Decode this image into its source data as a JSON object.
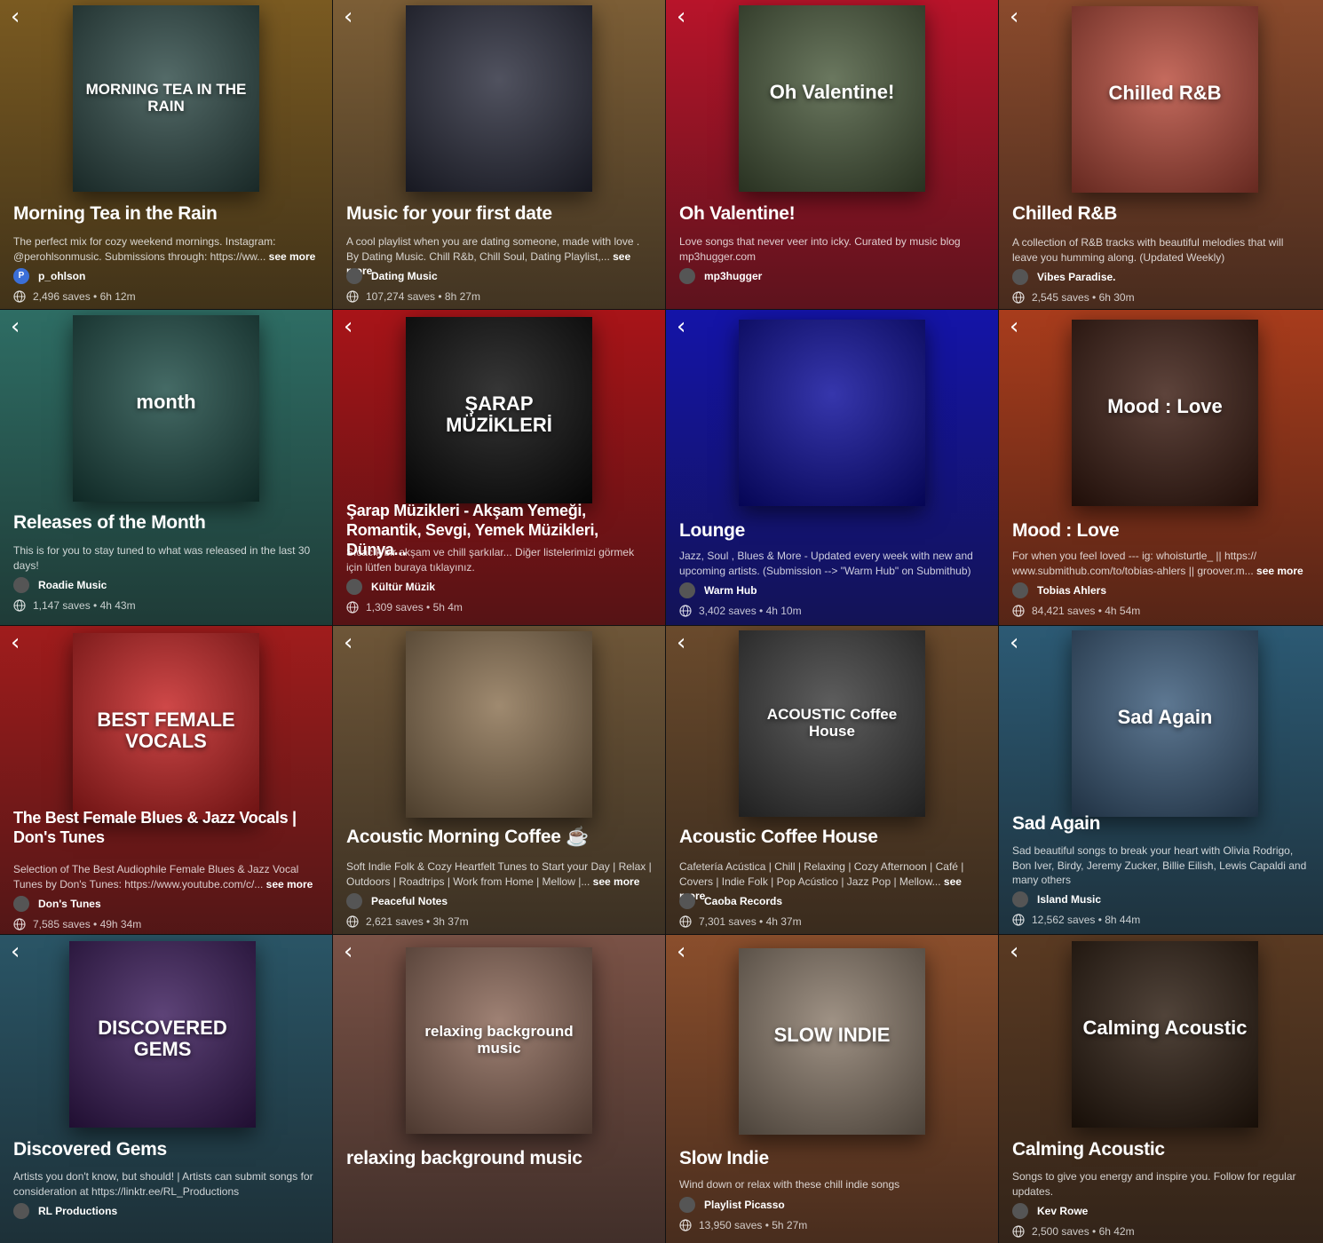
{
  "ui": {
    "back_glyph": "‹",
    "see_more": "see more"
  },
  "playlists": [
    {
      "title": "Morning Tea in the Rain",
      "cover_text": "MORNING TEA IN THE RAIN",
      "description": "The perfect mix for cozy weekend mornings. Instagram: @perohlsonmusic. Submissions through: https://ww...",
      "owner": "p_ohlson",
      "avatar_letter": "P",
      "saves": "2,496 saves",
      "duration": "6h 12m",
      "colors": {
        "bg": "#7a5a21",
        "art": "#2e4a47"
      }
    },
    {
      "title": "Music for your first date",
      "cover_text": "",
      "description": "A cool playlist when you are dating someone, made with love . By Dating Music. Chill R&b, Chill Soul, Dating Playlist,...",
      "owner": "Dating Music",
      "avatar_letter": "",
      "saves": "107,274 saves",
      "duration": "8h 27m",
      "colors": {
        "bg": "#7c5e36",
        "art": "#2a2c3c"
      }
    },
    {
      "title": "Oh Valentine!",
      "cover_text": "Oh Valentine!",
      "description": "Love songs that never veer into icky. Curated by music blog mp3hugger.com",
      "owner": "mp3hugger",
      "avatar_letter": "",
      "saves": "",
      "duration": "",
      "colors": {
        "bg": "#b8142a",
        "art": "#4a5a3c"
      }
    },
    {
      "title": "Chilled R&B",
      "cover_text": "Chilled R&B",
      "description": "A collection of R&B tracks with beautiful melodies that will leave you humming along. (Updated Weekly)",
      "owner": "Vibes Paradise.",
      "avatar_letter": "",
      "saves": "2,545 saves",
      "duration": "6h 30m",
      "colors": {
        "bg": "#8a4a2c",
        "art": "#b84a3a"
      }
    },
    {
      "title": "Releases of the Month",
      "cover_text": "month",
      "description": "This is for you to stay tuned to what was released in the last 30 days!",
      "owner": "Roadie Music",
      "avatar_letter": "",
      "saves": "1,147 saves",
      "duration": "4h 43m",
      "colors": {
        "bg": "#2e6d64",
        "art": "#1c4a44"
      }
    },
    {
      "title": "Şarap Müzikleri - Akşam Yemeği, Romantik, Sevgi, Yemek Müzikleri, Dünya...",
      "cover_text": "ŞARAP MÜZİKLERİ",
      "description": "Sıcacık bir akşam ve chill şarkılar... Diğer listelerimizi görmek için lütfen buraya tıklayınız.",
      "owner": "Kültür Müzik",
      "avatar_letter": "",
      "saves": "1,309 saves",
      "duration": "5h 4m",
      "colors": {
        "bg": "#a81418",
        "art": "#0a0a0a"
      }
    },
    {
      "title": "Lounge",
      "cover_text": "",
      "description": "Jazz, Soul , Blues & More - Updated every week with new and upcoming artists. (Submission --> \"Warm Hub\" on Submithub)",
      "owner": "Warm Hub",
      "avatar_letter": "",
      "saves": "3,402 saves",
      "duration": "4h 10m",
      "colors": {
        "bg": "#1414a8",
        "art": "#0a0a9a"
      }
    },
    {
      "title": "Mood : Love",
      "cover_text": "Mood : Love",
      "description": "For when you feel loved --- ig: whoisturtle_ || https:// www.submithub.com/to/tobias-ahlers || groover.m...",
      "owner": "Tobias Ahlers",
      "avatar_letter": "",
      "saves": "84,421 saves",
      "duration": "4h 54m",
      "colors": {
        "bg": "#a83c1c",
        "art": "#3a1a10"
      }
    },
    {
      "title": "The Best Female Blues & Jazz Vocals | Don's Tunes",
      "cover_text": "BEST FEMALE VOCALS",
      "description": "Selection of The Best Audiophile Female Blues & Jazz Vocal Tunes by Don's Tunes: https://www.youtube.com/c/...",
      "owner": "Don's Tunes",
      "avatar_letter": "",
      "saves": "7,585 saves",
      "duration": "49h 34m",
      "colors": {
        "bg": "#a01c1c",
        "art": "#c42020"
      }
    },
    {
      "title": "Acoustic Morning Coffee ☕",
      "cover_text": "",
      "description": "Soft Indie Folk & Cozy Heartfelt Tunes to Start your Day | Relax | Outdoors | Roadtrips | Work from Home | Mellow |...",
      "owner": "Peaceful Notes",
      "avatar_letter": "",
      "saves": "2,621 saves",
      "duration": "3h 37m",
      "colors": {
        "bg": "#6e5638",
        "art": "#8a7050"
      }
    },
    {
      "title": "Acoustic Coffee House",
      "cover_text": "ACOUSTIC Coffee House",
      "description": "Cafetería Acústica | Chill | Relaxing | Cozy Afternoon | Café | Covers | Indie Folk | Pop Acústico | Jazz Pop | Mellow...",
      "owner": "Caoba Records",
      "avatar_letter": "",
      "saves": "7,301 saves",
      "duration": "4h 37m",
      "colors": {
        "bg": "#6a4a2c",
        "art": "#3a3a3a"
      }
    },
    {
      "title": "Sad Again",
      "cover_text": "Sad Again",
      "description": "Sad beautiful songs to break your heart with Olivia Rodrigo, Bon Iver, Birdy, Jeremy Zucker, Billie Eilish, Lewis Capaldi and many others",
      "owner": "Island Music",
      "avatar_letter": "",
      "saves": "12,562 saves",
      "duration": "8h 44m",
      "colors": {
        "bg": "#2c5a74",
        "art": "#3a5a7a"
      }
    },
    {
      "title": "Discovered Gems",
      "cover_text": "DISCOVERED GEMS",
      "description": "Artists you don't know, but should! | Artists can submit songs for consideration at https://linktr.ee/RL_Productions",
      "owner": "RL Productions",
      "avatar_letter": "",
      "saves": "",
      "duration": "",
      "colors": {
        "bg": "#2a5566",
        "art": "#3a1a5a"
      }
    },
    {
      "title": "relaxing background music",
      "cover_text": "relaxing background music",
      "description": "",
      "owner": "",
      "avatar_letter": "",
      "saves": "",
      "duration": "",
      "colors": {
        "bg": "#7a5246",
        "art": "#8a6656"
      }
    },
    {
      "title": "Slow Indie",
      "cover_text": "SLOW INDIE",
      "description": "Wind down or relax with these chill indie songs",
      "owner": "Playlist Picasso",
      "avatar_letter": "",
      "saves": "13,950 saves",
      "duration": "5h 27m",
      "colors": {
        "bg": "#8a4e2c",
        "art": "#8a7a6a"
      }
    },
    {
      "title": "Calming Acoustic",
      "cover_text": "Calming Acoustic",
      "description": "Songs to give you energy and inspire you. Follow for regular updates.",
      "owner": "Kev Rowe",
      "avatar_letter": "",
      "saves": "2,500 saves",
      "duration": "6h 42m",
      "colors": {
        "bg": "#5a3a22",
        "art": "#2a1a0e"
      }
    }
  ]
}
